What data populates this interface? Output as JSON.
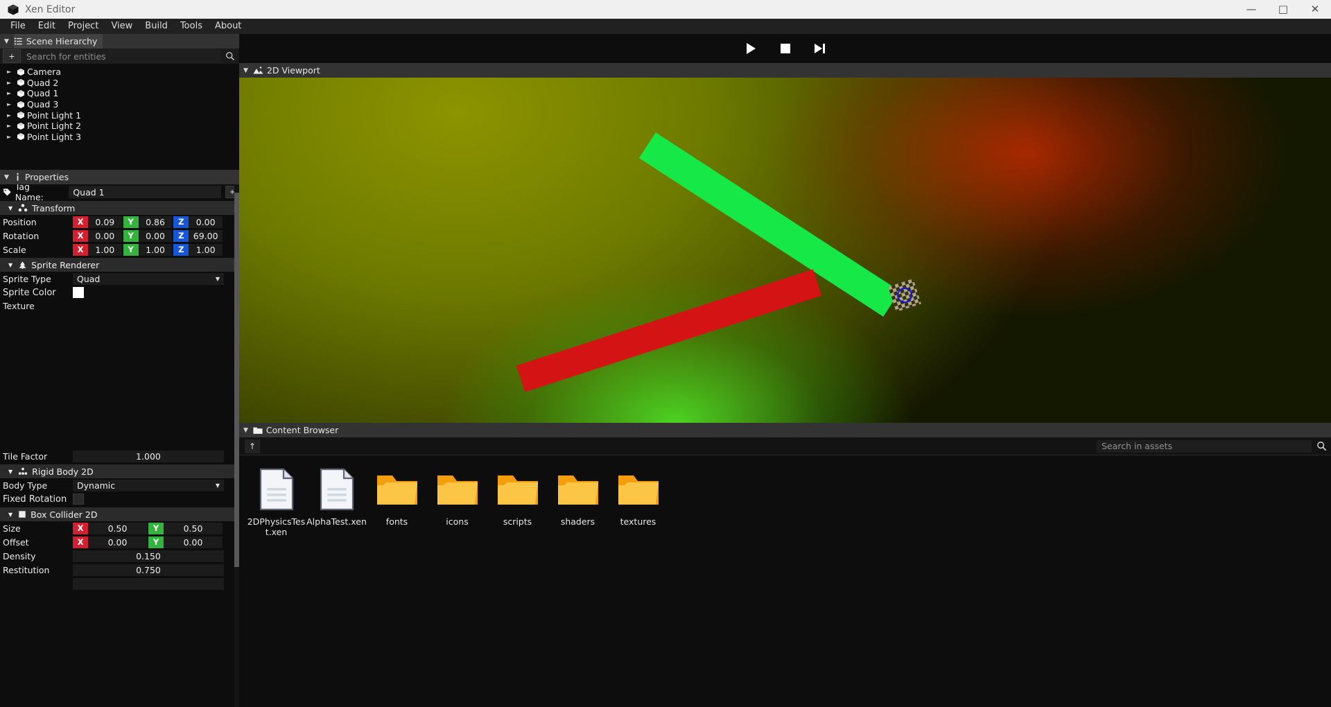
{
  "window": {
    "title": "Xen Editor",
    "logo_icon": "cube-icon",
    "minimize_label": "—",
    "maximize_label": "□",
    "close_label": "✕"
  },
  "menubar": {
    "items": [
      {
        "label": "File"
      },
      {
        "label": "Edit"
      },
      {
        "label": "Project"
      },
      {
        "label": "View"
      },
      {
        "label": "Build"
      },
      {
        "label": "Tools"
      },
      {
        "label": "About"
      }
    ]
  },
  "hierarchy": {
    "title": "Scene Hierarchy",
    "icon": "list-icon",
    "add_label": "+",
    "search": {
      "placeholder": "Search for entities",
      "value": ""
    },
    "entities": [
      {
        "label": "Camera"
      },
      {
        "label": "Quad 2"
      },
      {
        "label": "Quad 1"
      },
      {
        "label": "Quad 3"
      },
      {
        "label": "Point Light 1"
      },
      {
        "label": "Point Light 2"
      },
      {
        "label": "Point Light 3"
      }
    ]
  },
  "properties": {
    "title": "Properties",
    "icon": "info-icon",
    "tag": {
      "label": "Tag Name:",
      "value": "Quad 1",
      "add_label": "+"
    },
    "transform": {
      "title": "Transform",
      "rows": [
        {
          "label": "Position",
          "x": "0.09",
          "y": "0.86",
          "z": "0.00"
        },
        {
          "label": "Rotation",
          "x": "0.00",
          "y": "0.00",
          "z": "69.00"
        },
        {
          "label": "Scale",
          "x": "1.00",
          "y": "1.00",
          "z": "1.00"
        }
      ],
      "axis_x": "X",
      "axis_y": "Y",
      "axis_z": "Z"
    },
    "sprite_renderer": {
      "title": "Sprite Renderer",
      "sprite_type_label": "Sprite Type",
      "sprite_type_value": "Quad",
      "sprite_color_label": "Sprite Color",
      "sprite_color_value": "#ffffff",
      "texture_label": "Texture",
      "tile_factor_label": "Tile Factor",
      "tile_factor_value": "1.000"
    },
    "rigid_body_2d": {
      "title": "Rigid Body 2D",
      "body_type_label": "Body Type",
      "body_type_value": "Dynamic",
      "fixed_rotation_label": "Fixed Rotation",
      "fixed_rotation_checked": false
    },
    "box_collider_2d": {
      "title": "Box Collider 2D",
      "size_label": "Size",
      "size_x": "0.50",
      "size_y": "0.50",
      "offset_label": "Offset",
      "offset_x": "0.00",
      "offset_y": "0.00",
      "density_label": "Density",
      "density_value": "0.150",
      "restitution_label": "Restitution",
      "restitution_value": "0.750",
      "axis_x": "X",
      "axis_y": "Y"
    }
  },
  "toolbar": {
    "play_label": "play-button",
    "stop_label": "stop-button",
    "step_label": "step-button"
  },
  "viewport": {
    "title": "2D Viewport",
    "icon": "image-icon"
  },
  "content_browser": {
    "title": "Content Browser",
    "icon": "folder-icon",
    "up_label": "↑",
    "search": {
      "placeholder": "Search in assets",
      "value": ""
    },
    "assets": [
      {
        "name": "2DPhysicsTest.xen",
        "type": "file"
      },
      {
        "name": "AlphaTest.xen",
        "type": "file"
      },
      {
        "name": "fonts",
        "type": "folder"
      },
      {
        "name": "icons",
        "type": "folder"
      },
      {
        "name": "scripts",
        "type": "folder"
      },
      {
        "name": "shaders",
        "type": "folder"
      },
      {
        "name": "textures",
        "type": "folder"
      }
    ]
  },
  "colors": {
    "axis_x": "#d32030",
    "axis_y": "#33b33e",
    "axis_z": "#1756d8",
    "folder": "#f5a623",
    "green_quad": "#16e847",
    "red_quad": "#d41414",
    "collider": "#1111ee"
  }
}
